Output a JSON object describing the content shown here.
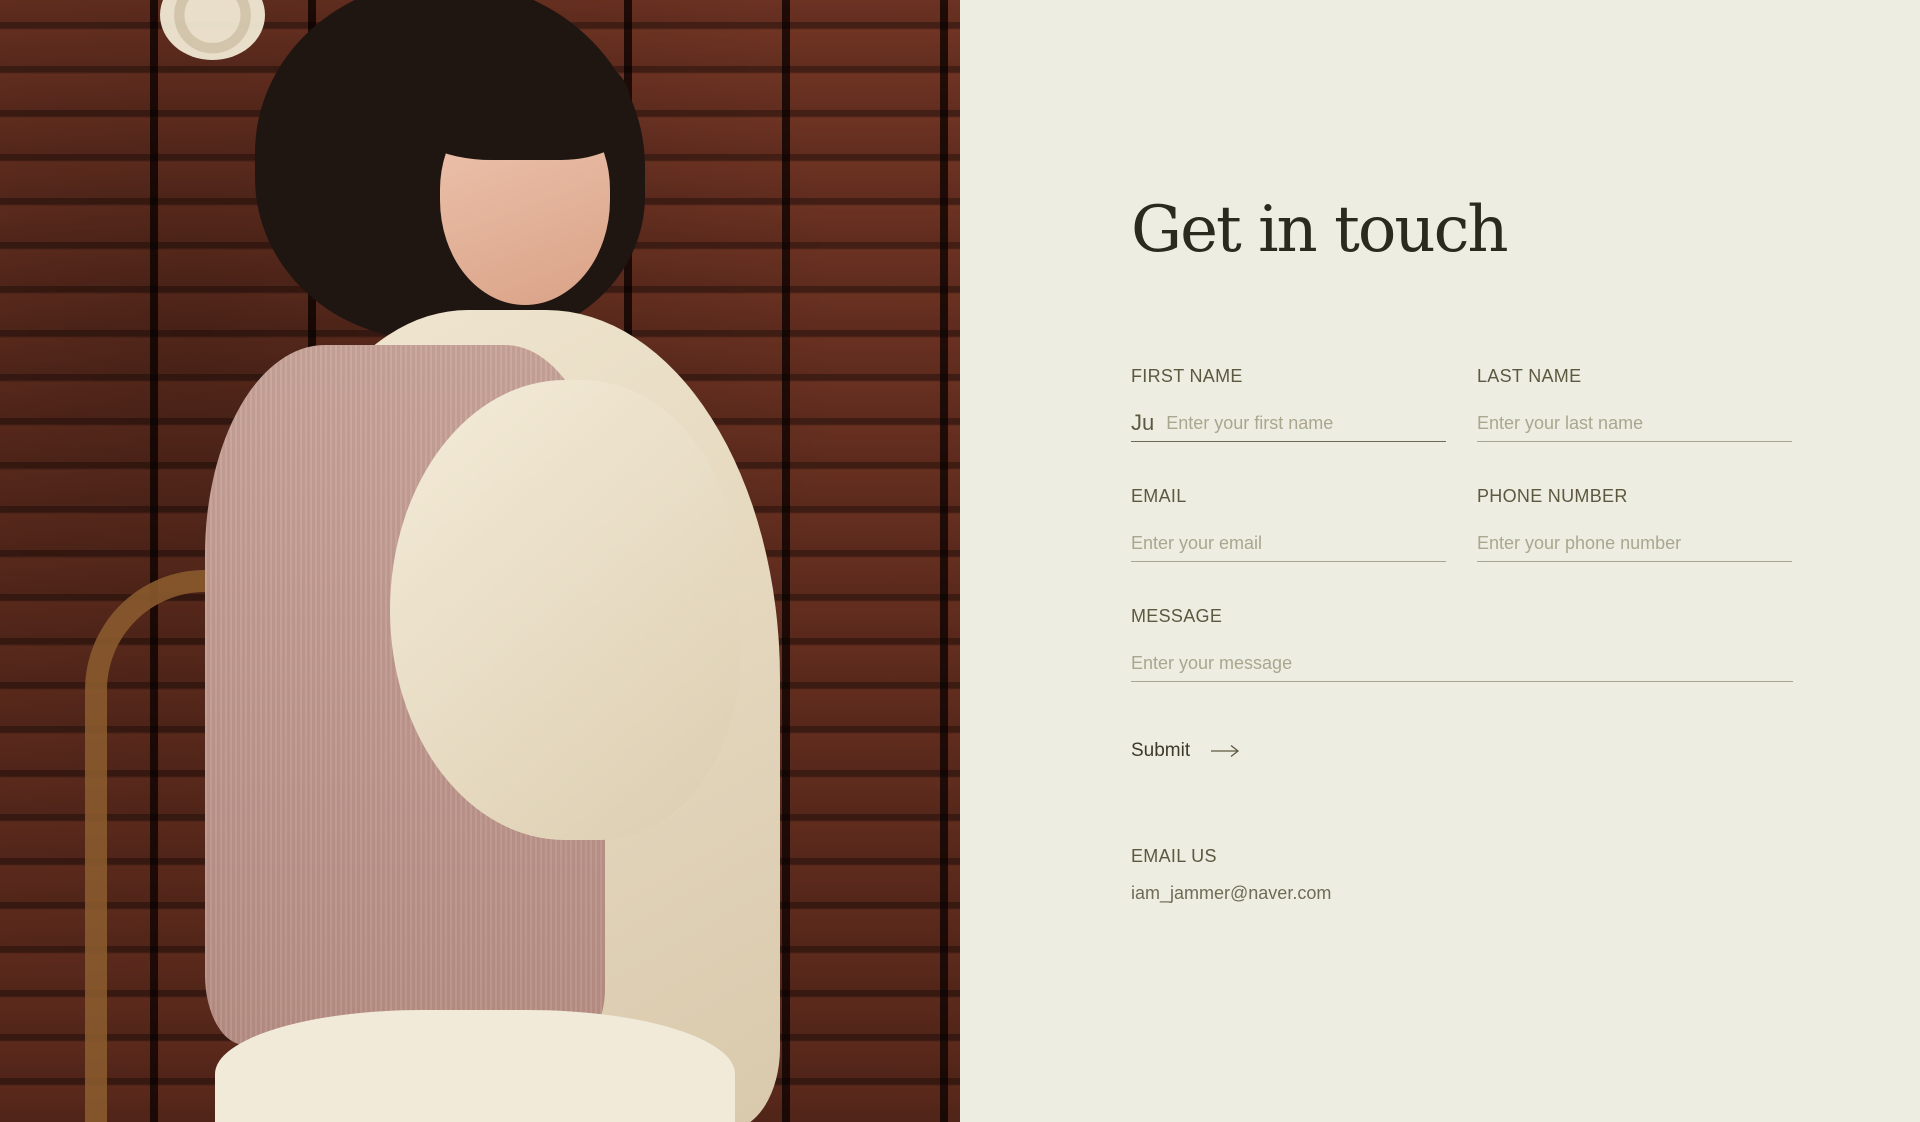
{
  "heading": "Get in touch",
  "form": {
    "first_name": {
      "label": "FIRST NAME",
      "value": "Ju",
      "placeholder": "Enter your first name"
    },
    "last_name": {
      "label": "LAST NAME",
      "placeholder": "Enter your last name"
    },
    "email": {
      "label": "EMAIL",
      "placeholder": "Enter your email"
    },
    "phone": {
      "label": "PHONE NUMBER",
      "placeholder": "Enter your phone number"
    },
    "message": {
      "label": "MESSAGE",
      "placeholder": "Enter your message"
    },
    "submit_label": "Submit",
    "submit_icon": "arrow-right-icon"
  },
  "contact": {
    "label": "EMAIL US",
    "email": "iam_jammer@naver.com"
  },
  "colors": {
    "background": "#eeede2",
    "heading": "#2a2a1f",
    "label": "#5d5840",
    "placeholder": "#a9a78f",
    "rule": "#a8a795"
  }
}
